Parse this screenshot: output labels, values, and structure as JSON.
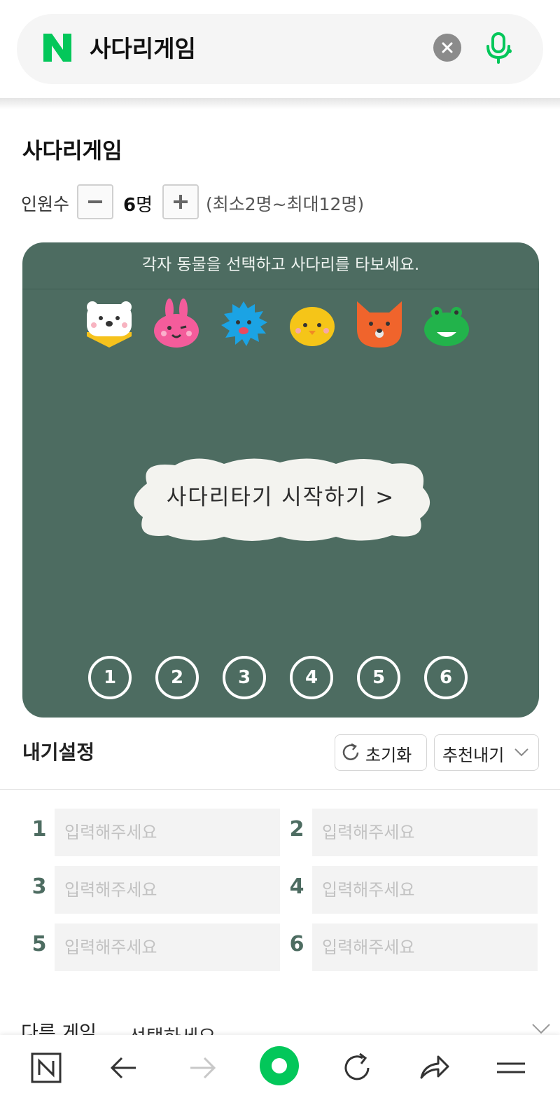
{
  "search": {
    "query": "사다리게임",
    "logo_icon": "naver-n-logo-icon",
    "clear_icon": "clear-x-icon",
    "mic_icon": "microphone-icon",
    "brand_color": "#03c75a"
  },
  "ladder": {
    "title": "사다리게임",
    "count_label": "인원수",
    "minus_icon": "minus-icon",
    "plus_icon": "plus-icon",
    "count_number": "6",
    "count_unit": "명",
    "count_range": "(최소2명~최대12명)",
    "instruction": "각자 동물을 선택하고 사다리를 타보세요.",
    "start_label": "사다리타기 시작하기 >",
    "board_color": "#4d6c61",
    "animals": [
      {
        "icon": "white-bear-icon"
      },
      {
        "icon": "pink-rabbit-icon"
      },
      {
        "icon": "blue-hedgehog-icon"
      },
      {
        "icon": "yellow-chick-icon"
      },
      {
        "icon": "orange-fox-icon"
      },
      {
        "icon": "green-frog-icon"
      }
    ],
    "numbers": [
      "1",
      "2",
      "3",
      "4",
      "5",
      "6"
    ]
  },
  "prizes": {
    "title": "내기설정",
    "reset_label": "초기화",
    "reset_icon": "refresh-icon",
    "recommend_label": "추천내기",
    "recommend_icon": "chevron-down-icon",
    "items": [
      {
        "num": "1",
        "placeholder": "입력해주세요"
      },
      {
        "num": "2",
        "placeholder": "입력해주세요"
      },
      {
        "num": "3",
        "placeholder": "입력해주세요"
      },
      {
        "num": "4",
        "placeholder": "입력해주세요"
      },
      {
        "num": "5",
        "placeholder": "입력해주세요"
      },
      {
        "num": "6",
        "placeholder": "입력해주세요"
      }
    ]
  },
  "other_game": {
    "label": "다른 게임",
    "select_placeholder": "선택하세요"
  },
  "bottom_nav": {
    "items": [
      {
        "icon": "naver-home-icon"
      },
      {
        "icon": "back-arrow-icon"
      },
      {
        "icon": "forward-arrow-icon"
      },
      {
        "icon": "green-dot-icon"
      },
      {
        "icon": "refresh-icon"
      },
      {
        "icon": "share-icon"
      },
      {
        "icon": "menu-icon"
      }
    ]
  }
}
